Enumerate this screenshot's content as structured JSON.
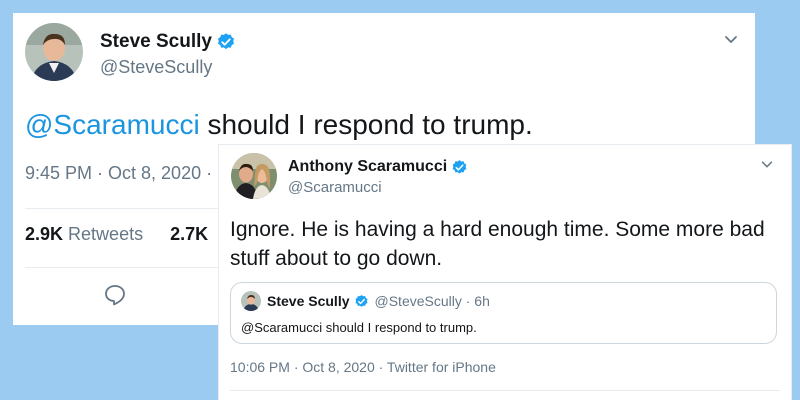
{
  "tweet1": {
    "author": {
      "name": "Steve Scully",
      "handle": "@SteveScully"
    },
    "mention": "@Scaramucci",
    "text": " should I respond to trump.",
    "timestamp": "9:45 PM · Oct 8, 2020 · ",
    "stats": {
      "retweets_count": "2.9K",
      "retweets_label": "Retweets",
      "likes_count": "2.7K"
    },
    "icons": {
      "menu": "chevron-down-icon",
      "reply": "reply-bubble-icon",
      "verified": "verified-badge-icon"
    }
  },
  "tweet2": {
    "author": {
      "name": "Anthony Scaramucci",
      "handle": "@Scaramucci"
    },
    "text": "Ignore. He is having a hard enough time. Some more bad stuff about to go down.",
    "quoted": {
      "name": "Steve Scully",
      "meta": "@SteveScully · 6h",
      "text": "@Scaramucci should I respond to trump."
    },
    "timestamp": "10:06 PM · Oct 8, 2020 · Twitter for iPhone",
    "icons": {
      "menu": "chevron-down-icon",
      "verified": "verified-badge-icon"
    }
  },
  "colors": {
    "background": "#9ccbf2",
    "link": "#1b95e0",
    "muted": "#657786",
    "verified": "#1da1f2"
  }
}
